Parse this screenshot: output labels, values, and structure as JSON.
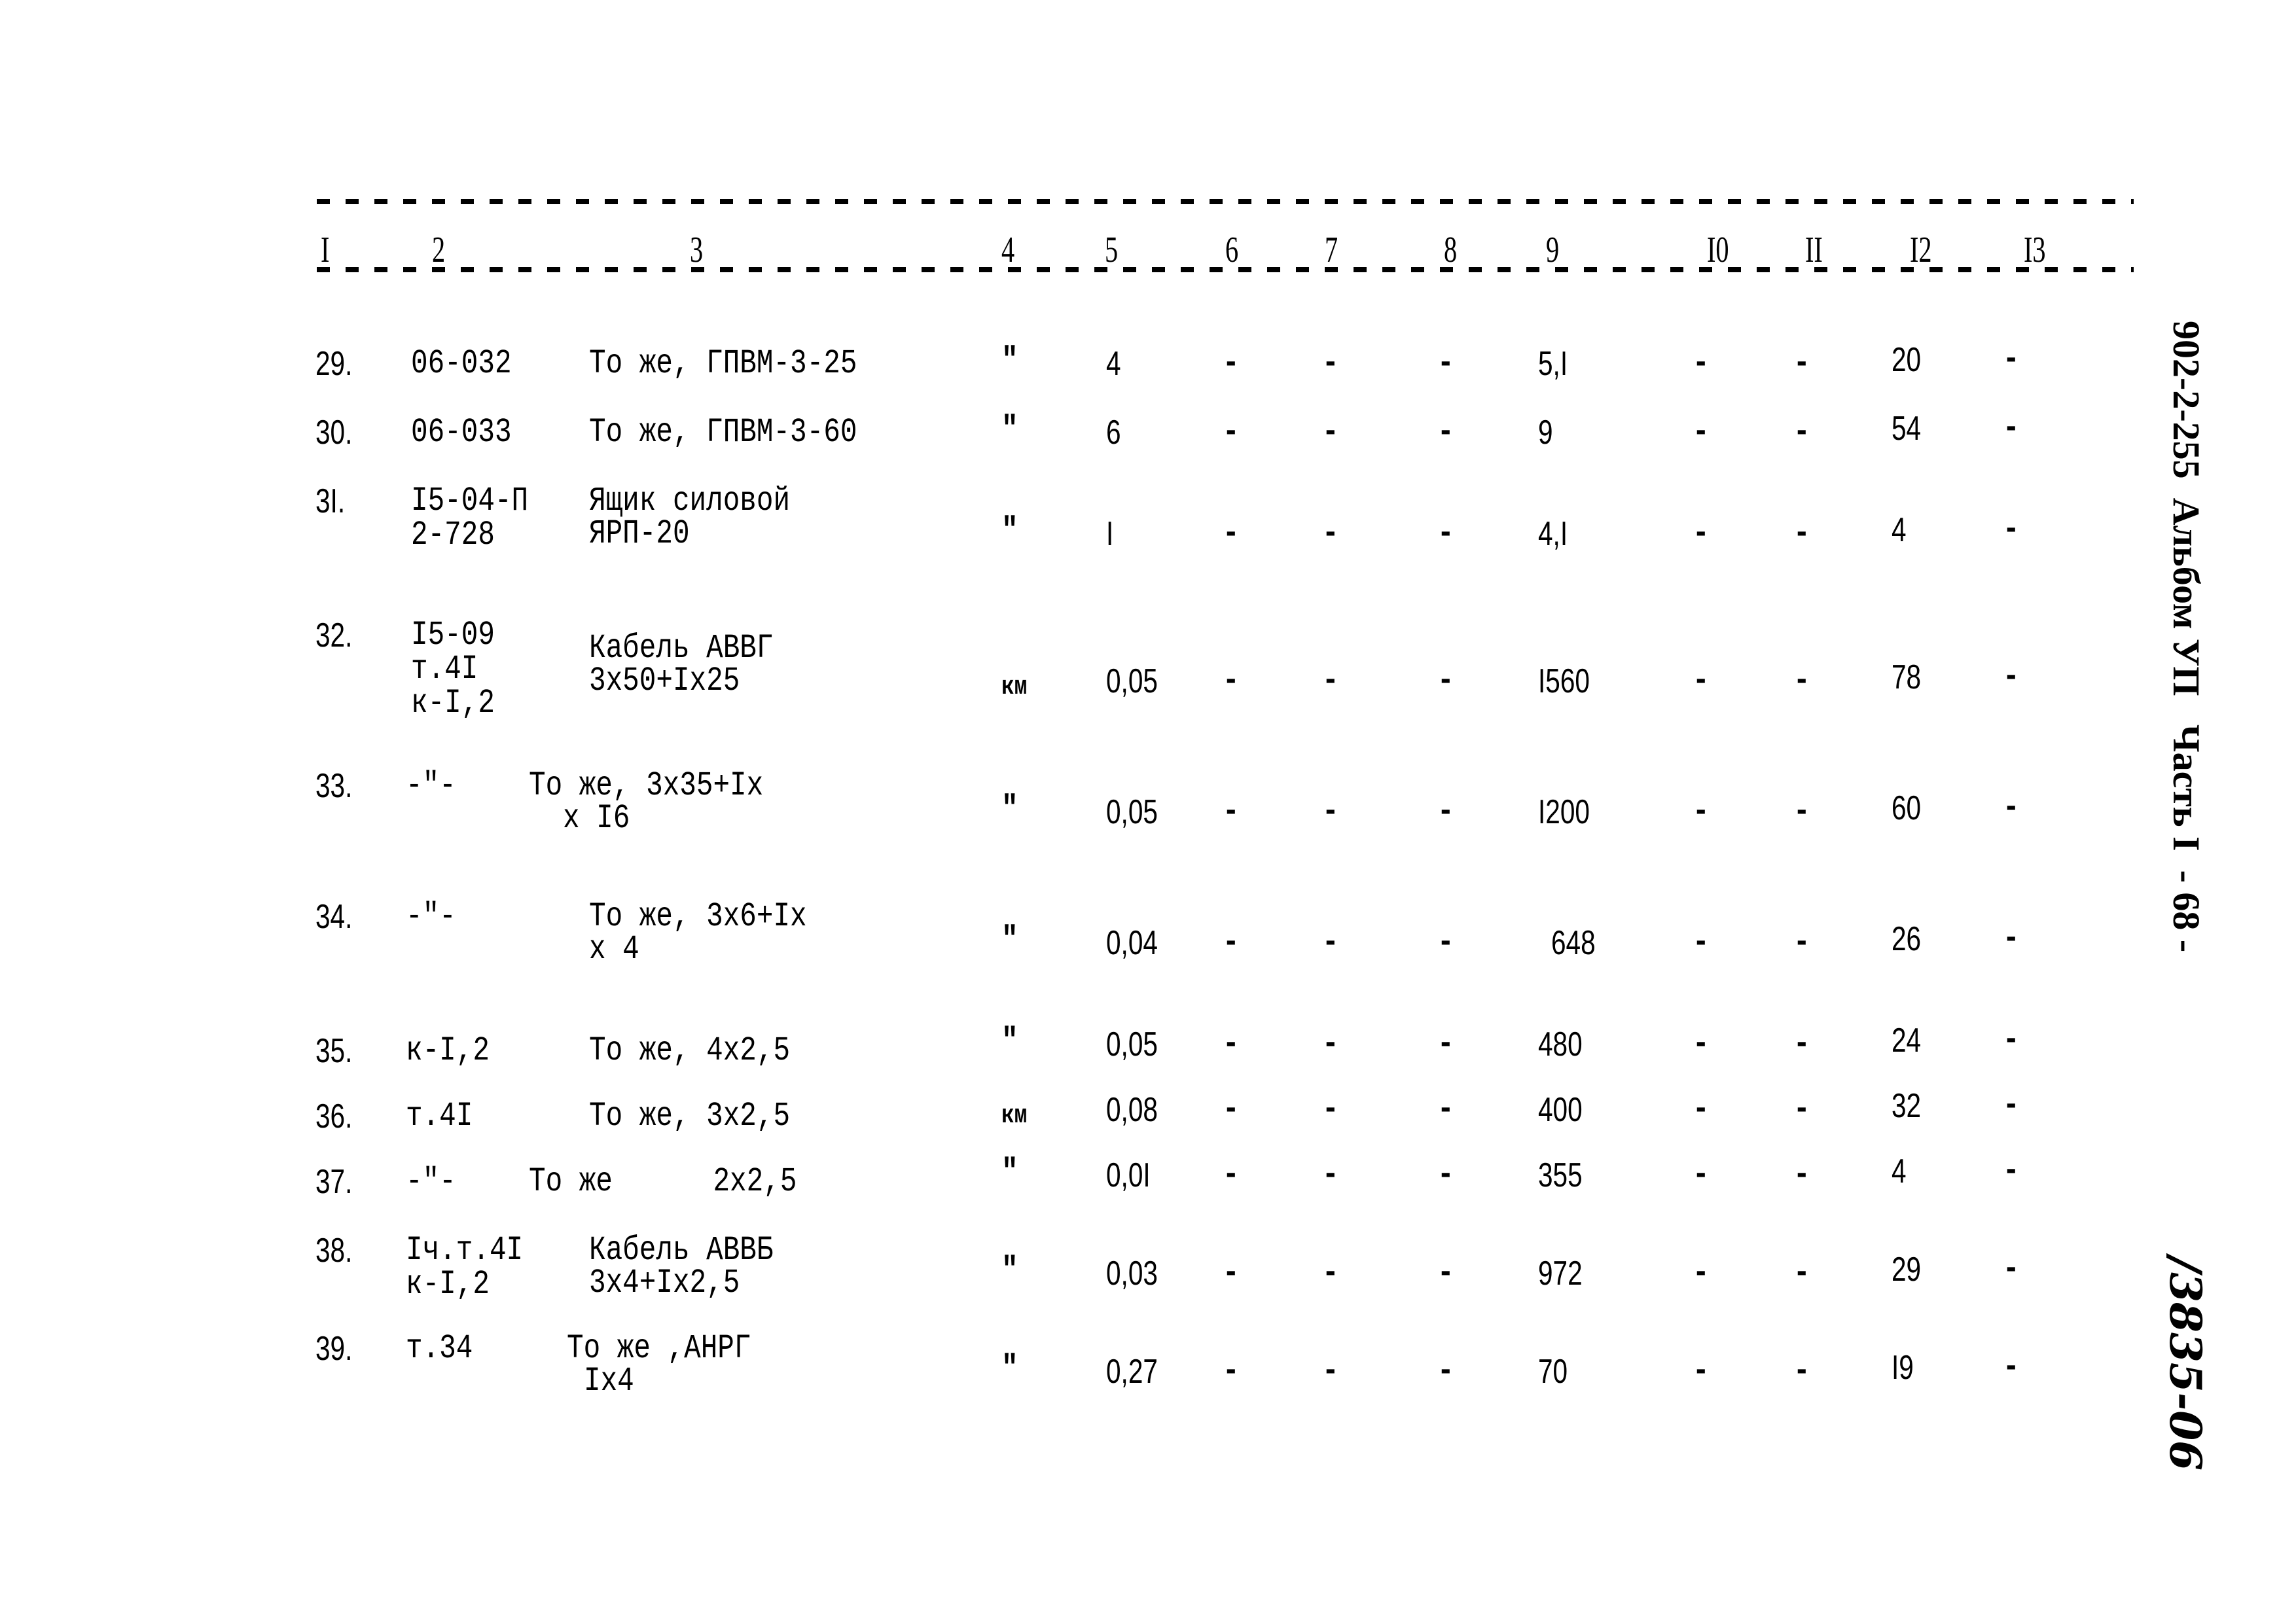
{
  "header": {
    "columns": [
      "I",
      "2",
      "3",
      "4",
      "5",
      "6",
      "7",
      "8",
      "9",
      "I0",
      "II",
      "I2",
      "I3"
    ]
  },
  "rows": [
    {
      "n": "29.",
      "code": [
        "06-032"
      ],
      "name": [
        "То же, ГПВМ-3-25"
      ],
      "unit": "\"",
      "c5": "4",
      "c6": "-",
      "c7": "-",
      "c8": "-",
      "c9": "5,I",
      "c10": "-",
      "c11": "-",
      "c12": "20",
      "c13": "-"
    },
    {
      "n": "30.",
      "code": [
        "06-033"
      ],
      "name": [
        "То же, ГПВМ-3-60"
      ],
      "unit": "\"",
      "c5": "6",
      "c6": "-",
      "c7": "-",
      "c8": "-",
      "c9": "9",
      "c10": "-",
      "c11": "-",
      "c12": "54",
      "c13": "-"
    },
    {
      "n": "3I.",
      "code": [
        "I5-04-П",
        "2-728"
      ],
      "name": [
        "Ящик силовой",
        "ЯРП-20"
      ],
      "unit": "\"",
      "c5": "I",
      "c6": "-",
      "c7": "-",
      "c8": "-",
      "c9": "4,I",
      "c10": "-",
      "c11": "-",
      "c12": "4",
      "c13": "-"
    },
    {
      "n": "32.",
      "code": [
        "I5-09",
        "т.4I",
        "к-I,2"
      ],
      "name": [
        "Кабель АВВГ",
        "3х50+Iх25"
      ],
      "unit": "км",
      "c5": "0,05",
      "c6": "-",
      "c7": "-",
      "c8": "-",
      "c9": "I560",
      "c10": "-",
      "c11": "-",
      "c12": "78",
      "c13": "-"
    },
    {
      "n": "33.",
      "code": [
        "-\"-"
      ],
      "name": [
        "То же, 3х35+Iх",
        "х I6"
      ],
      "unit": "\"",
      "c5": "0,05",
      "c6": "-",
      "c7": "-",
      "c8": "-",
      "c9": "I200",
      "c10": "-",
      "c11": "-",
      "c12": "60",
      "c13": "-"
    },
    {
      "n": "34.",
      "code": [
        "-\"-"
      ],
      "name": [
        "То же, 3х6+Iх",
        "х 4"
      ],
      "unit": "\"",
      "c5": "0,04",
      "c6": "-",
      "c7": "-",
      "c8": "-",
      "c9": "648",
      "c10": "-",
      "c11": "-",
      "c12": "26",
      "c13": "-"
    },
    {
      "n": "35.",
      "code": [
        "к-I,2"
      ],
      "name": [
        "То же, 4х2,5"
      ],
      "unit": "\"",
      "c5": "0,05",
      "c6": "-",
      "c7": "-",
      "c8": "-",
      "c9": "480",
      "c10": "-",
      "c11": "-",
      "c12": "24",
      "c13": "-"
    },
    {
      "n": "36.",
      "code": [
        "т.4I"
      ],
      "name": [
        "То же, 3х2,5"
      ],
      "unit": "км",
      "c5": "0,08",
      "c6": "-",
      "c7": "-",
      "c8": "-",
      "c9": "400",
      "c10": "-",
      "c11": "-",
      "c12": "32",
      "c13": "-"
    },
    {
      "n": "37.",
      "code": [
        "-\"-"
      ],
      "name": [
        "То же      2х2,5"
      ],
      "unit": "\"",
      "c5": "0,0I",
      "c6": "-",
      "c7": "-",
      "c8": "-",
      "c9": "355",
      "c10": "-",
      "c11": "-",
      "c12": "4",
      "c13": "-"
    },
    {
      "n": "38.",
      "code": [
        "Iч.т.4I",
        "к-I,2"
      ],
      "name": [
        "Кабель АВВБ",
        "3х4+Iх2,5"
      ],
      "unit": "\"",
      "c5": "0,03",
      "c6": "-",
      "c7": "-",
      "c8": "-",
      "c9": "972",
      "c10": "-",
      "c11": "-",
      "c12": "29",
      "c13": "-"
    },
    {
      "n": "39.",
      "code": [
        "т.34"
      ],
      "name": [
        "То же ,АНРГ",
        "Iх4"
      ],
      "unit": "\"",
      "c5": "0,27",
      "c6": "-",
      "c7": "-",
      "c8": "-",
      "c9": "70",
      "c10": "-",
      "c11": "-",
      "c12": "I9",
      "c13": "-"
    }
  ],
  "side_stamp": {
    "text": "902-2-255  Альбом УП   Часть I  - 68 -",
    "handwritten": "/3835-06"
  }
}
